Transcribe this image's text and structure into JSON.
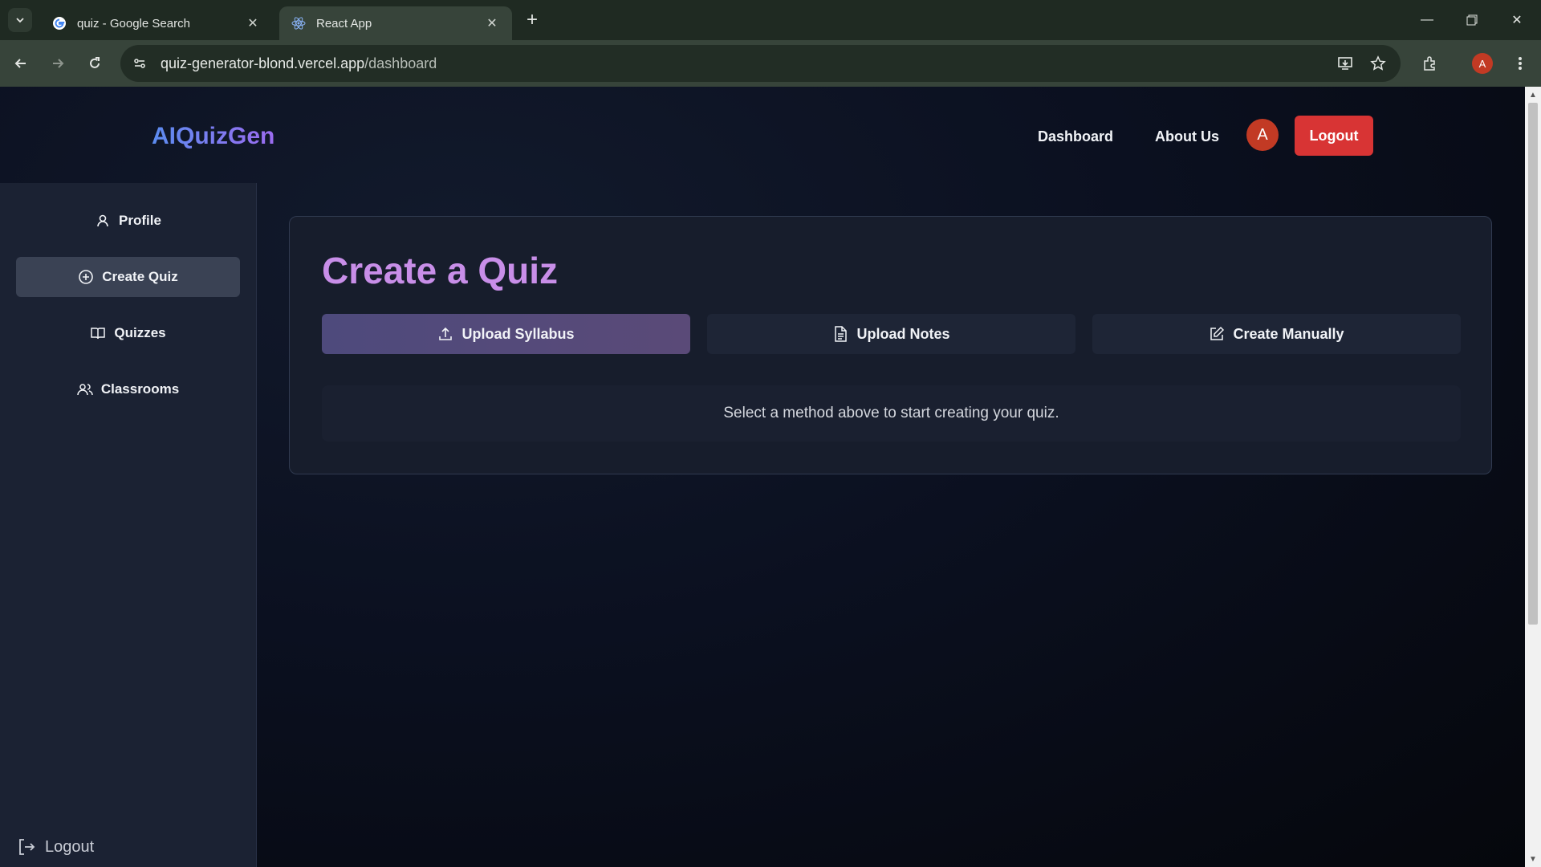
{
  "browser": {
    "tabs": [
      {
        "title": "quiz - Google Search",
        "icon": "google-icon",
        "active": false
      },
      {
        "title": "React App",
        "icon": "react-icon",
        "active": true
      }
    ],
    "url_host": "quiz-generator-blond.vercel.app",
    "url_path": "/dashboard",
    "profile_initial": "A"
  },
  "header": {
    "brand": "AIQuizGen",
    "nav": [
      "Dashboard",
      "About Us"
    ],
    "avatar_initial": "A",
    "logout_label": "Logout"
  },
  "sidebar": {
    "items": [
      {
        "label": "Profile",
        "icon": "user-icon",
        "active": false
      },
      {
        "label": "Create Quiz",
        "icon": "plus-circle-icon",
        "active": true
      },
      {
        "label": "Quizzes",
        "icon": "book-icon",
        "active": false
      },
      {
        "label": "Classrooms",
        "icon": "users-icon",
        "active": false
      }
    ],
    "logout_label": "Logout"
  },
  "main": {
    "title": "Create a Quiz",
    "methods": [
      {
        "label": "Upload Syllabus",
        "icon": "upload-icon",
        "active": true
      },
      {
        "label": "Upload Notes",
        "icon": "file-text-icon",
        "active": false
      },
      {
        "label": "Create Manually",
        "icon": "edit-icon",
        "active": false
      }
    ],
    "hint": "Select a method above to start creating your quiz."
  },
  "colors": {
    "brand_gradient_start": "#5b8cf0",
    "brand_gradient_end": "#9b6cf0",
    "title": "#c88ee8",
    "logout": "#d83434",
    "avatar": "#c23a24"
  }
}
